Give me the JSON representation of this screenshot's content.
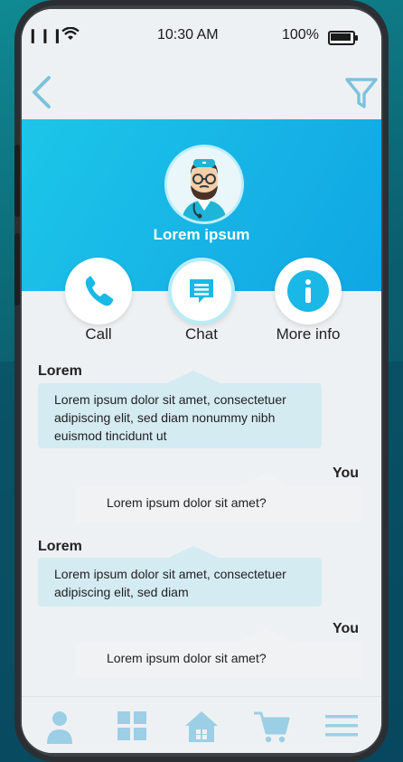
{
  "status": {
    "signal": "❙❙❙",
    "time": "10:30 AM",
    "battery": "100%"
  },
  "nav": {
    "back_icon": "chevron-left-icon",
    "filter_icon": "filter-icon"
  },
  "profile": {
    "name": "Lorem ipsum"
  },
  "actions": [
    {
      "label": "Call",
      "icon": "phone-icon"
    },
    {
      "label": "Chat",
      "icon": "chat-icon"
    },
    {
      "label": "More info",
      "icon": "info-icon"
    }
  ],
  "messages": [
    {
      "sender": "Lorem",
      "text": "Lorem ipsum dolor sit amet, consectetuer adipiscing elit, sed diam nonummy nibh euismod tincidunt ut"
    },
    {
      "sender": "You",
      "text": "Lorem ipsum dolor sit amet?"
    },
    {
      "sender": "Lorem",
      "text": "Lorem ipsum dolor sit amet, consectetuer adipiscing elit, sed diam"
    },
    {
      "sender": "You",
      "text": "Lorem ipsum dolor sit amet?"
    }
  ],
  "tabs": [
    {
      "name": "profile",
      "icon": "person-icon"
    },
    {
      "name": "grid",
      "icon": "grid-icon"
    },
    {
      "name": "home",
      "icon": "home-icon"
    },
    {
      "name": "cart",
      "icon": "cart-icon"
    },
    {
      "name": "menu",
      "icon": "menu-icon"
    }
  ],
  "colors": {
    "accent": "#1ab8e6",
    "icon_light": "#9ccfe5",
    "bubble_in": "#d4ebf2",
    "bubble_out": "#f1f2f3"
  }
}
